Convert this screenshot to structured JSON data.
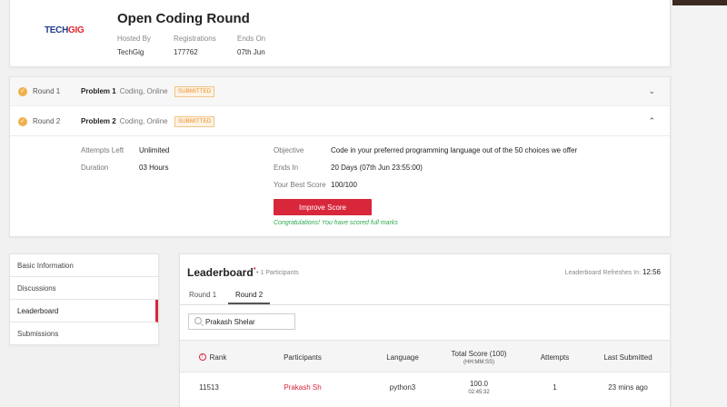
{
  "header": {
    "logo_text_a": "TECH",
    "logo_text_b": "GIG",
    "title": "Open Coding Round",
    "meta": [
      {
        "key": "Hosted By",
        "value": "TechGig"
      },
      {
        "key": "Registrations",
        "value": "177762"
      },
      {
        "key": "Ends On",
        "value": "07th Jun"
      }
    ]
  },
  "rounds": [
    {
      "label": "Round 1",
      "problem": "Problem 1",
      "type": "Coding, Online",
      "badge": "SUBMITTED",
      "expanded": false
    },
    {
      "label": "Round 2",
      "problem": "Problem 2",
      "type": "Coding, Online",
      "badge": "SUBMITTED",
      "expanded": true
    }
  ],
  "round2_details": {
    "attempts_left_label": "Attempts Left",
    "attempts_left_value": "Unlimited",
    "duration_label": "Duration",
    "duration_value": "03 Hours",
    "objective_label": "Objective",
    "objective_value": "Code in your preferred programming language out of the 50 choices we offer",
    "ends_in_label": "Ends In",
    "ends_in_value": "20 Days (07th Jun 23:55:00)",
    "best_score_label": "Your Best Score",
    "best_score_value": "100/100",
    "improve_button": "Improve Score",
    "congrats": "Congratulations! You have scored full marks"
  },
  "nav": {
    "items": [
      "Basic Information",
      "Discussions",
      "Leaderboard",
      "Submissions"
    ],
    "active": "Leaderboard"
  },
  "leaderboard": {
    "title": "Leaderboard",
    "asterisk": "*",
    "participants": "• 1 Participants",
    "refresh_label": "Leaderboard Refreshes In:",
    "refresh_time": "12:56",
    "tabs": [
      "Round 1",
      "Round 2"
    ],
    "active_tab": "Round 2",
    "search_value": "Prakash Shelar",
    "columns": {
      "rank": "Rank",
      "participants": "Participants",
      "language": "Language",
      "total_score": "Total Score (100)",
      "total_score_sub": "(HH:MM:SS)",
      "attempts": "Attempts",
      "last_submitted": "Last Submitted"
    },
    "rows": [
      {
        "rank": "11513",
        "participant": "Prakash Sh",
        "language": "python3",
        "score": "100.0",
        "time": "02:45:32",
        "attempts": "1",
        "last_submitted": "23 mins ago"
      }
    ]
  },
  "colors": {
    "accent": "#d8273b",
    "badge": "#e88a20",
    "check": "#f0b04a",
    "success": "#2fa84f"
  }
}
